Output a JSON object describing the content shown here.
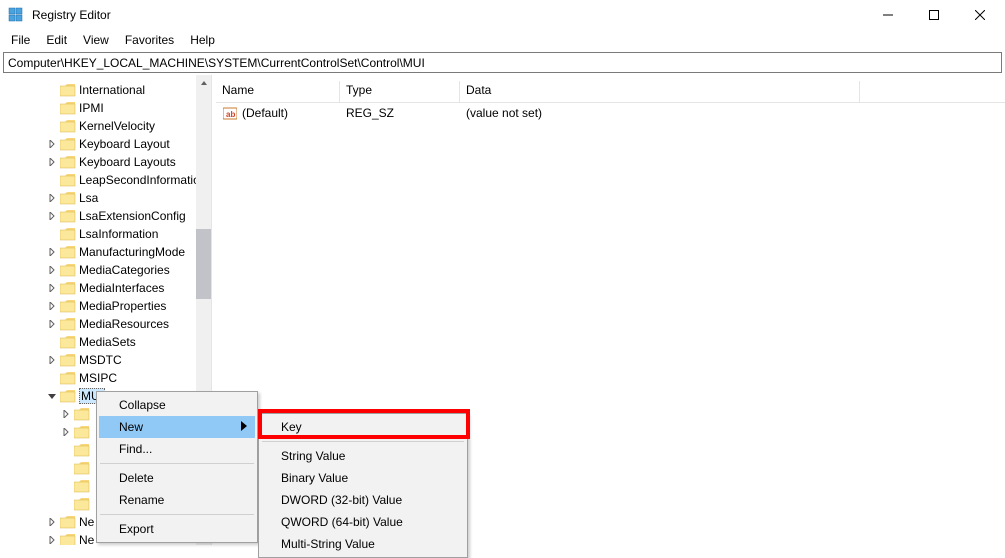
{
  "title": "Registry Editor",
  "menus": {
    "file": "File",
    "edit": "Edit",
    "view": "View",
    "favorites": "Favorites",
    "help": "Help"
  },
  "address": "Computer\\HKEY_LOCAL_MACHINE\\SYSTEM\\CurrentControlSet\\Control\\MUI",
  "tree": [
    {
      "indent": 3,
      "exp": "",
      "label": "International"
    },
    {
      "indent": 3,
      "exp": "",
      "label": "IPMI"
    },
    {
      "indent": 3,
      "exp": "",
      "label": "KernelVelocity"
    },
    {
      "indent": 3,
      "exp": ">",
      "label": "Keyboard Layout"
    },
    {
      "indent": 3,
      "exp": ">",
      "label": "Keyboard Layouts"
    },
    {
      "indent": 3,
      "exp": "",
      "label": "LeapSecondInformation"
    },
    {
      "indent": 3,
      "exp": ">",
      "label": "Lsa"
    },
    {
      "indent": 3,
      "exp": ">",
      "label": "LsaExtensionConfig"
    },
    {
      "indent": 3,
      "exp": "",
      "label": "LsaInformation"
    },
    {
      "indent": 3,
      "exp": ">",
      "label": "ManufacturingMode"
    },
    {
      "indent": 3,
      "exp": ">",
      "label": "MediaCategories"
    },
    {
      "indent": 3,
      "exp": ">",
      "label": "MediaInterfaces"
    },
    {
      "indent": 3,
      "exp": ">",
      "label": "MediaProperties"
    },
    {
      "indent": 3,
      "exp": ">",
      "label": "MediaResources"
    },
    {
      "indent": 3,
      "exp": "",
      "label": "MediaSets"
    },
    {
      "indent": 3,
      "exp": ">",
      "label": "MSDTC"
    },
    {
      "indent": 3,
      "exp": "",
      "label": "MSIPC"
    },
    {
      "indent": 3,
      "exp": "v",
      "label": "MUI",
      "selected": true
    },
    {
      "indent": 4,
      "exp": ">",
      "label": " "
    },
    {
      "indent": 4,
      "exp": ">",
      "label": " "
    },
    {
      "indent": 4,
      "exp": "",
      "label": " "
    },
    {
      "indent": 4,
      "exp": "",
      "label": " "
    },
    {
      "indent": 4,
      "exp": "",
      "label": " "
    },
    {
      "indent": 4,
      "exp": "",
      "label": " "
    },
    {
      "indent": 3,
      "exp": ">",
      "label": "Ne"
    },
    {
      "indent": 3,
      "exp": ">",
      "label": "Ne"
    }
  ],
  "columns": {
    "name": "Name",
    "type": "Type",
    "data": "Data"
  },
  "colwidths": {
    "name": 124,
    "type": 120,
    "data": 400
  },
  "values": [
    {
      "name": "(Default)",
      "type": "REG_SZ",
      "data": "(value not set)"
    }
  ],
  "ctx": {
    "collapse": "Collapse",
    "new": "New",
    "find": "Find...",
    "delete": "Delete",
    "rename": "Rename",
    "export": "Export"
  },
  "submenu": {
    "key": "Key",
    "string": "String Value",
    "binary": "Binary Value",
    "dword": "DWORD (32-bit) Value",
    "qword": "QWORD (64-bit) Value",
    "multi": "Multi-String Value"
  }
}
